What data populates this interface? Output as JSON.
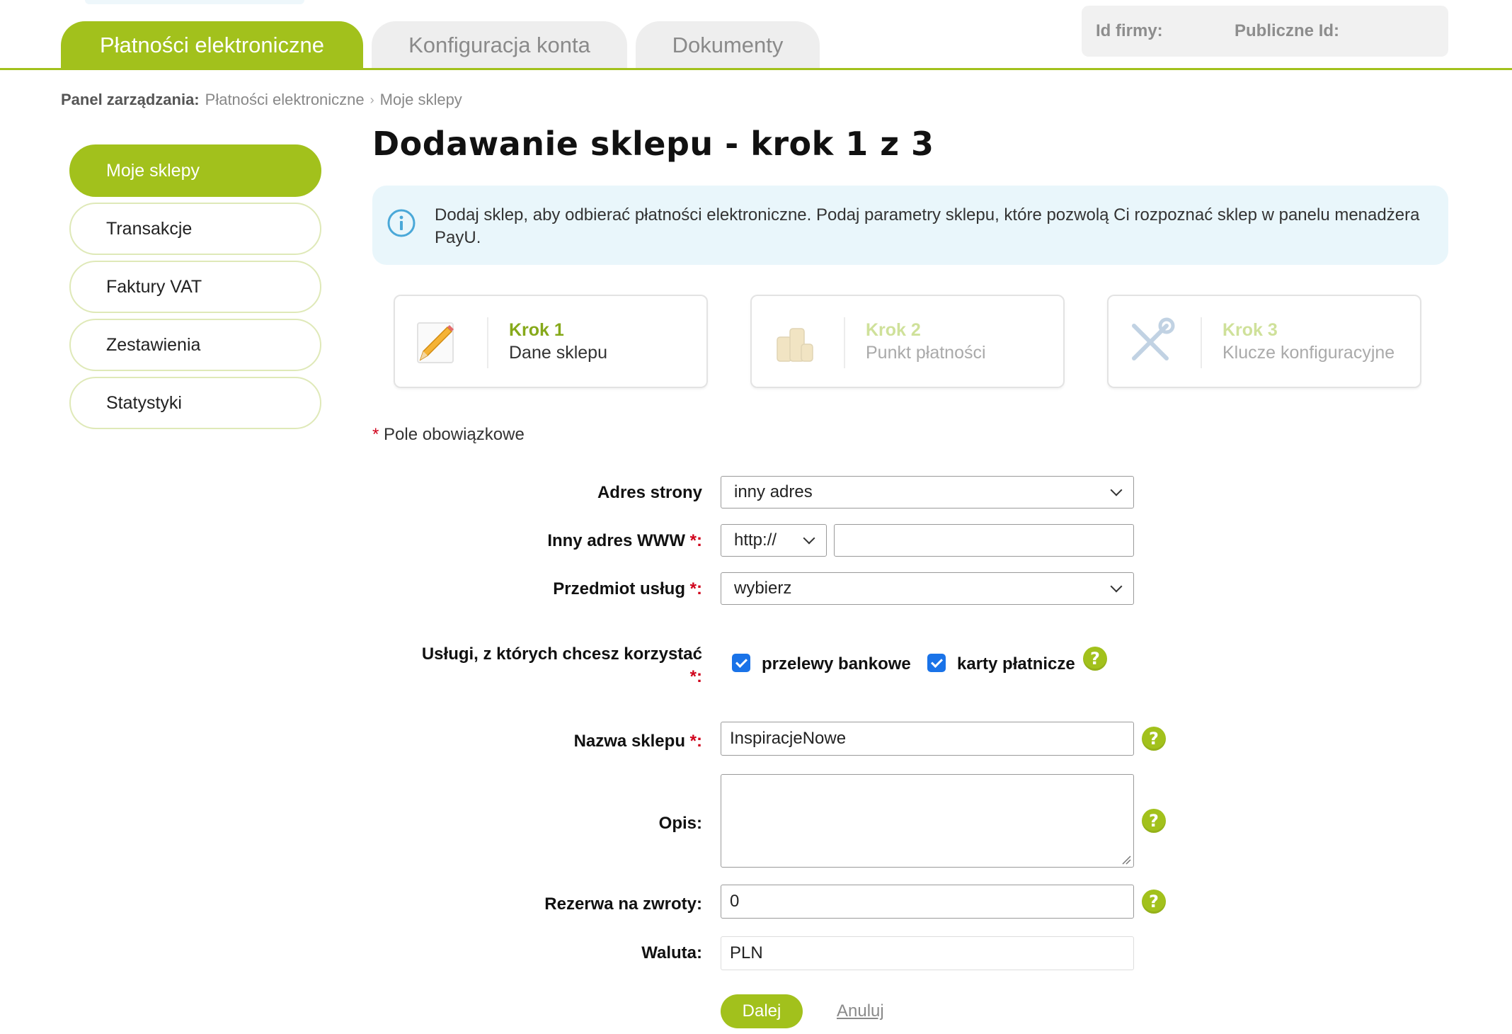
{
  "tabs": [
    "Płatności elektroniczne",
    "Konfiguracja konta",
    "Dokumenty"
  ],
  "id_box": {
    "company_id_label": "Id firmy:",
    "public_id_label": "Publiczne Id:"
  },
  "breadcrumb": {
    "title": "Panel zarządzania:",
    "items": [
      "Płatności elektroniczne",
      "Moje sklepy"
    ],
    "separator": "›"
  },
  "sidebar": {
    "items": [
      "Moje sklepy",
      "Transakcje",
      "Faktury VAT",
      "Zestawienia",
      "Statystyki"
    ],
    "active_index": 0
  },
  "page_title": "Dodawanie sklepu - krok 1 z 3",
  "info": {
    "icon": "info-icon",
    "text": "Dodaj sklep, aby odbierać płatności elektroniczne. Podaj parametry sklepu, które pozwolą Ci rozpoznać sklep w panelu menadżera PayU."
  },
  "steps": [
    {
      "step": "Krok 1",
      "name": "Dane sklepu",
      "icon": "pencil-icon",
      "active": true
    },
    {
      "step": "Krok 2",
      "name": "Punkt płatności",
      "icon": "coins-icon",
      "active": false
    },
    {
      "step": "Krok 3",
      "name": "Klucze konfiguracyjne",
      "icon": "tools-icon",
      "active": false
    }
  ],
  "required_note": {
    "star": "*",
    "text": "Pole obowiązkowe"
  },
  "form": {
    "address": {
      "label": "Adres strony",
      "value": "inny adres"
    },
    "www": {
      "label": "Inny adres WWW",
      "star": "*:",
      "protocol": "http://",
      "value": ""
    },
    "subject": {
      "label": "Przedmiot usług",
      "star": "*:",
      "value": "wybierz"
    },
    "services": {
      "label": "Usługi, z których chcesz korzystać",
      "star": "*:",
      "options": [
        {
          "label": "przelewy bankowe",
          "checked": true
        },
        {
          "label": "karty płatnicze",
          "checked": true
        }
      ]
    },
    "shop_name": {
      "label": "Nazwa sklepu",
      "star": "*:",
      "value": "InspiracjeNowe"
    },
    "description": {
      "label": "Opis:",
      "value": ""
    },
    "refund_reserve": {
      "label": "Rezerwa na zwroty:",
      "value": "0"
    },
    "currency": {
      "label": "Waluta:",
      "value": "PLN"
    },
    "help_symbol": "?"
  },
  "actions": {
    "next": "Dalej",
    "cancel": "Anuluj"
  },
  "colors": {
    "accent": "#a2c11c",
    "info_bg": "#e9f6fb",
    "required": "#d0021b",
    "checkbox": "#1a73e8"
  }
}
